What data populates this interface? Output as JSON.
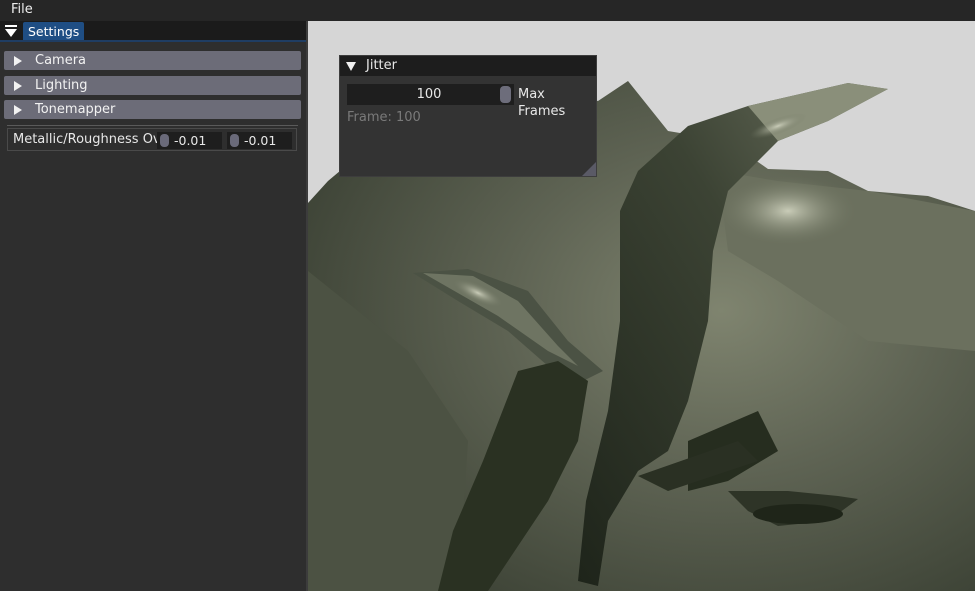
{
  "menu": {
    "file": "File"
  },
  "settings_panel": {
    "tab_label": "Settings",
    "sections": [
      {
        "label": "Camera"
      },
      {
        "label": "Lighting"
      },
      {
        "label": "Tonemapper"
      }
    ],
    "metallic_roughness": {
      "label": "Metallic/Roughness Ove",
      "metallic_value": "-0.01",
      "roughness_value": "-0.01"
    }
  },
  "jitter_window": {
    "title": "Jitter",
    "max_frames_value": "100",
    "max_frames_label": "Max Frames",
    "frame_counter": "Frame: 100"
  },
  "colors": {
    "accent": "#1f4e84",
    "header": "#6c6c78",
    "viewport_background": "#d6d6d6",
    "model_base": "#5f6354",
    "model_dark": "#22281c"
  },
  "icons": [
    "collapse-arrow-icon",
    "expand-triangle-icon",
    "resize-grip-icon"
  ]
}
